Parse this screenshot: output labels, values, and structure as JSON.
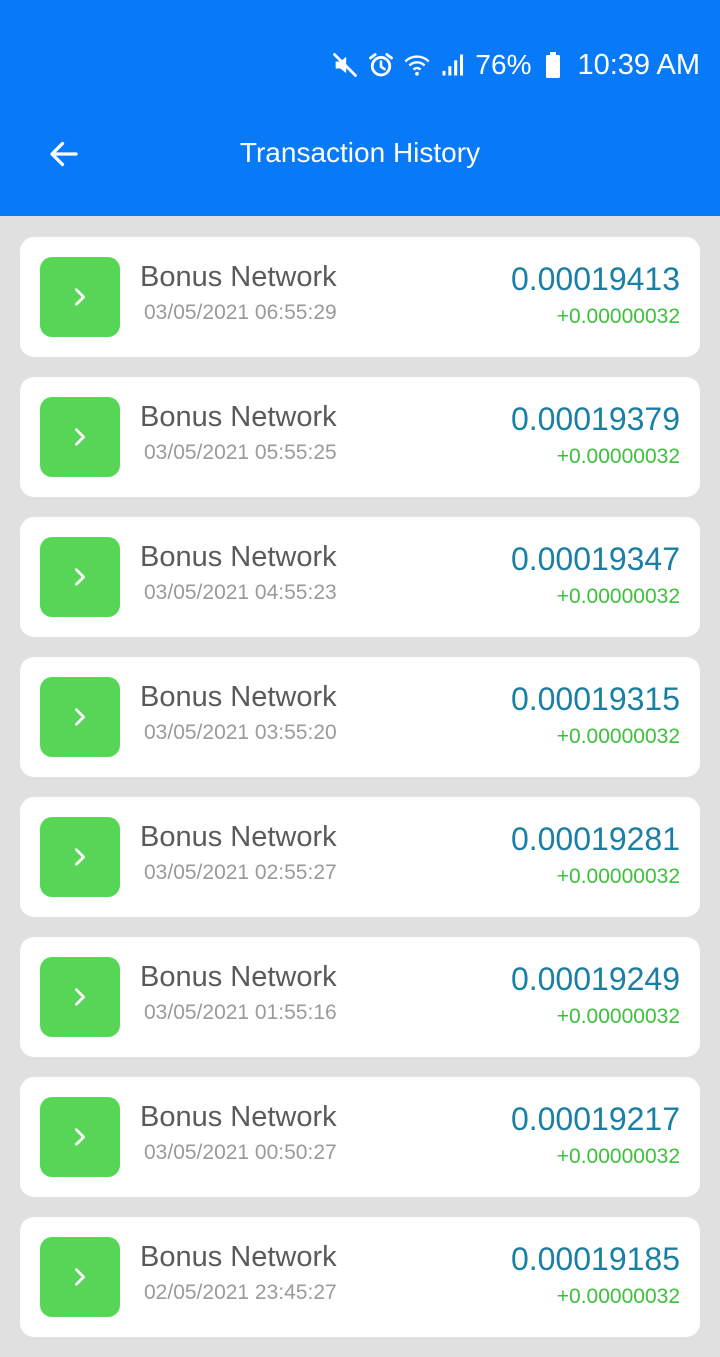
{
  "status_bar": {
    "battery_percent": "76%",
    "time": "10:39 AM",
    "icons": [
      "mute-icon",
      "alarm-icon",
      "wifi-icon",
      "signal-icon",
      "battery-icon"
    ]
  },
  "toolbar": {
    "title": "Transaction History",
    "back_icon": "arrow-left-icon"
  },
  "colors": {
    "header": "#0879f7",
    "background": "#e0e0e0",
    "tile": "#57d557",
    "balance": "#1a7fa5",
    "delta": "#3cc13c"
  },
  "transactions": [
    {
      "title": "Bonus Network",
      "date": "03/05/2021 06:55:29",
      "balance": "0.00019413",
      "delta": "+0.00000032"
    },
    {
      "title": "Bonus Network",
      "date": "03/05/2021 05:55:25",
      "balance": "0.00019379",
      "delta": "+0.00000032"
    },
    {
      "title": "Bonus Network",
      "date": "03/05/2021 04:55:23",
      "balance": "0.00019347",
      "delta": "+0.00000032"
    },
    {
      "title": "Bonus Network",
      "date": "03/05/2021 03:55:20",
      "balance": "0.00019315",
      "delta": "+0.00000032"
    },
    {
      "title": "Bonus Network",
      "date": "03/05/2021 02:55:27",
      "balance": "0.00019281",
      "delta": "+0.00000032"
    },
    {
      "title": "Bonus Network",
      "date": "03/05/2021 01:55:16",
      "balance": "0.00019249",
      "delta": "+0.00000032"
    },
    {
      "title": "Bonus Network",
      "date": "03/05/2021 00:50:27",
      "balance": "0.00019217",
      "delta": "+0.00000032"
    },
    {
      "title": "Bonus Network",
      "date": "02/05/2021 23:45:27",
      "balance": "0.00019185",
      "delta": "+0.00000032"
    }
  ]
}
